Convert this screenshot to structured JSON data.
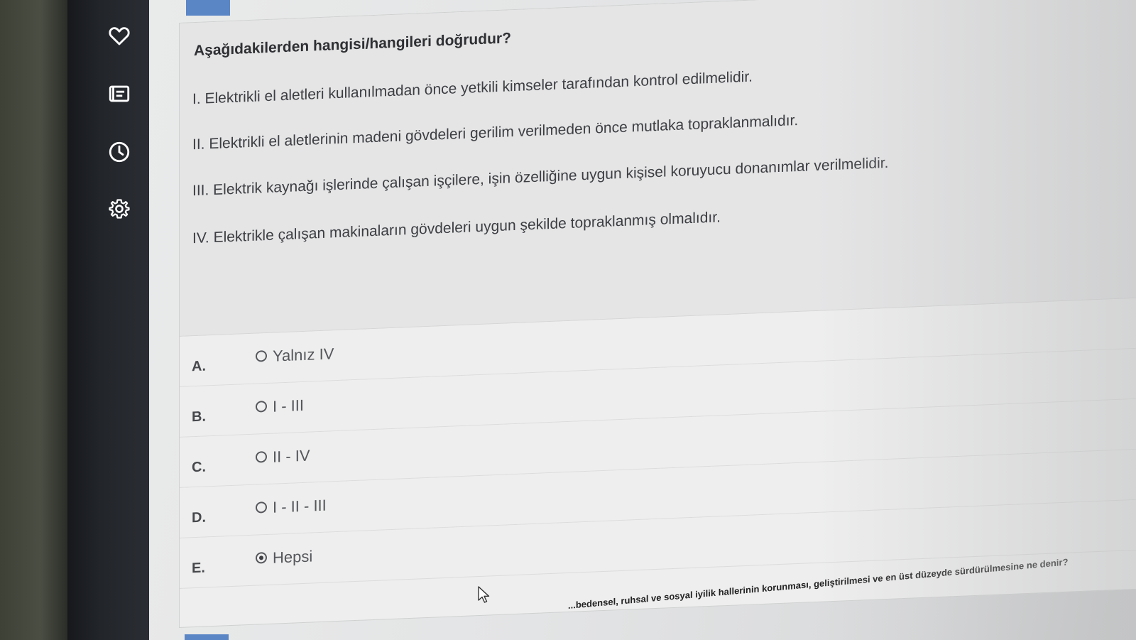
{
  "sidebar": {
    "icons": [
      "heart-icon",
      "notes-icon",
      "clock-icon",
      "gear-icon"
    ]
  },
  "question": {
    "title": "Aşağıdakilerden hangisi/hangileri doğrudur?",
    "statements": [
      {
        "lead": "I. Elektrikli el aletleri kullanılmadan önce yetkili kimseler tarafından kontrol edilmelidir."
      },
      {
        "lead": "II. Elektrikli el aletlerinin madeni gövdeleri gerilim verilmeden önce mutlaka topraklanmalıdır."
      },
      {
        "lead": "III. Elektrik kaynağı işlerinde çalışan işçilere, işin özelliğine uygun kişisel koruyucu donanımlar verilmelidir."
      },
      {
        "lead": "IV. Elektrikle çalışan makinaların gövdeleri uygun şekilde topraklanmış olmalıdır."
      }
    ]
  },
  "options": [
    {
      "letter": "A.",
      "text": "Yalnız IV",
      "selected": false
    },
    {
      "letter": "B.",
      "text": "I - III",
      "selected": false
    },
    {
      "letter": "C.",
      "text": "II - IV",
      "selected": false
    },
    {
      "letter": "D.",
      "text": "I - II - III",
      "selected": false
    },
    {
      "letter": "E.",
      "text": "Hepsi",
      "selected": true
    }
  ],
  "footer": {
    "text": "...bedensel, ruhsal ve sosyal iyilik hallerinin korunması, geliştirilmesi ve en üst düzeyde sürdürülmesine ne denir?"
  },
  "colors": {
    "sidebar_bg": "#1f2226",
    "accent_tab": "#5b86c6",
    "card_bg": "#eeeeee"
  }
}
